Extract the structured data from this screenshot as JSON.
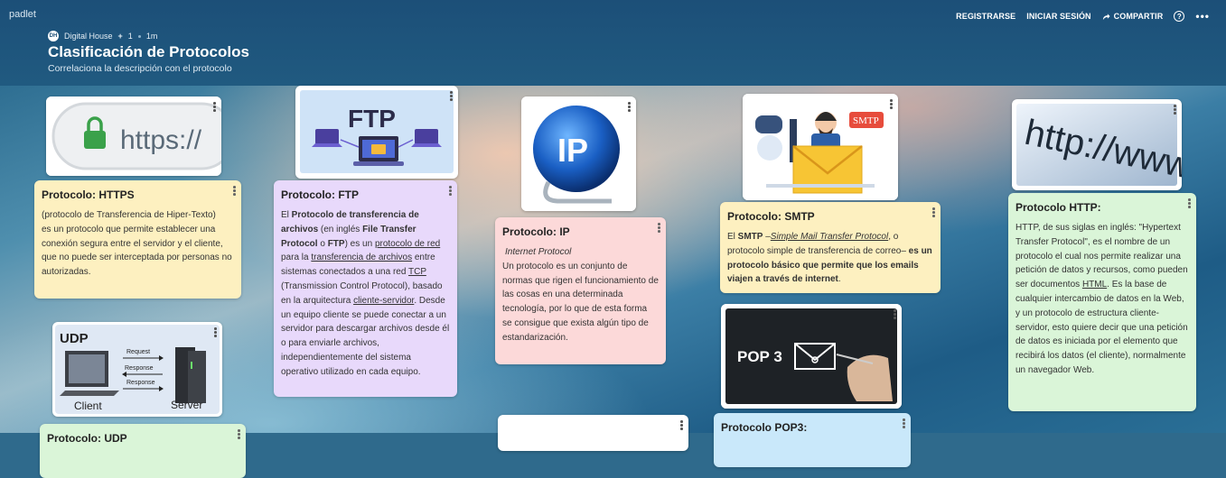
{
  "app": {
    "brand": "padlet"
  },
  "topbar": {
    "register": "REGISTRARSE",
    "login": "INICIAR SESIÓN",
    "share": "COMPARTIR",
    "help": "?",
    "more": "•••"
  },
  "header": {
    "author": "Digital House",
    "avatar_text": "DH",
    "likes": "1",
    "time": "1m",
    "title": "Clasificación de Protocolos",
    "subtitle": "Correlaciona la descripción con el protocolo"
  },
  "images": {
    "https": {
      "text": "https://"
    },
    "ftp": {
      "text": "FTP"
    },
    "ip": {
      "text": "IP"
    },
    "smtp": {
      "text": "SMTP"
    },
    "http": {
      "text": "http://www"
    },
    "udp": {
      "title": "UDP",
      "request": "Request",
      "response1": "Response",
      "response2": "Response",
      "client": "Client",
      "server": "Server"
    },
    "pop3": {
      "text": "POP 3"
    }
  },
  "cards": {
    "https": {
      "title": "Protocolo: HTTPS",
      "p1": "(protocolo de Transferencia de Hiper-Texto)",
      "p2": "es un protocolo que permite establecer una conexión segura entre el servidor y el cliente, que no puede ser interceptada por personas no autorizadas."
    },
    "ftp": {
      "title": "Protocolo: FTP",
      "t1": "El ",
      "b1": "Protocolo de transferencia de archivos",
      "t2": " (en inglés ",
      "b2": "File Transfer Protocol",
      "t3": " o ",
      "b3": "FTP",
      "t4": ") es un ",
      "u1": "protocolo de red",
      "t5": " para la ",
      "u2": "transferencia de archivos",
      "t6": " entre sistemas conectados a una red ",
      "u3": "TCP",
      "t7": " (Transmission Control Protocol), basado en la arquitectura ",
      "u4": "cliente-servidor",
      "t8": ". Desde un equipo cliente se puede conectar a un servidor para descargar archivos desde él o para enviarle archivos, independientemente del sistema operativo utilizado en cada equipo."
    },
    "ip": {
      "title": "Protocolo: IP",
      "italic": "Internet Protocol",
      "body": "Un protocolo es un conjunto de normas que rigen el funcionamiento de las cosas en una determinada tecnología, por lo que de esta forma se consigue que exista algún tipo de estandarización."
    },
    "smtp": {
      "title": "Protocolo: SMTP",
      "t1": "El ",
      "b1": "SMTP",
      "t2": " –",
      "u1": "Simple Mail Transfer Protocol",
      "t3": ", o protocolo simple de transferencia de correo– ",
      "b2": "es un protocolo básico que permite que los emails viajen a través de internet",
      "t4": "."
    },
    "http": {
      "title": "Protocolo HTTP:",
      "t1": "HTTP, de sus siglas en inglés: \"Hypertext Transfer Protocol\", es el nombre de un protocolo el cual nos permite realizar una petición de datos y recursos, como pueden ser documentos ",
      "u1": "HTML",
      "t2": ". Es la base de cualquier intercambio de datos en la Web, y un protocolo de estructura cliente-servidor, esto quiere decir que una petición de datos es iniciada por el elemento que recibirá los datos (el cliente), normalmente un navegador Web."
    },
    "pop3": {
      "title": "Protocolo POP3:"
    },
    "udp": {
      "title": "Protocolo: UDP"
    }
  },
  "colors": {
    "topbar": "#1c4f78",
    "yellow": "#fdf0c0",
    "purple": "#e8d9fb",
    "pink": "#fcd9d9",
    "green": "#daf5d8",
    "blue": "#c9e8fa"
  }
}
